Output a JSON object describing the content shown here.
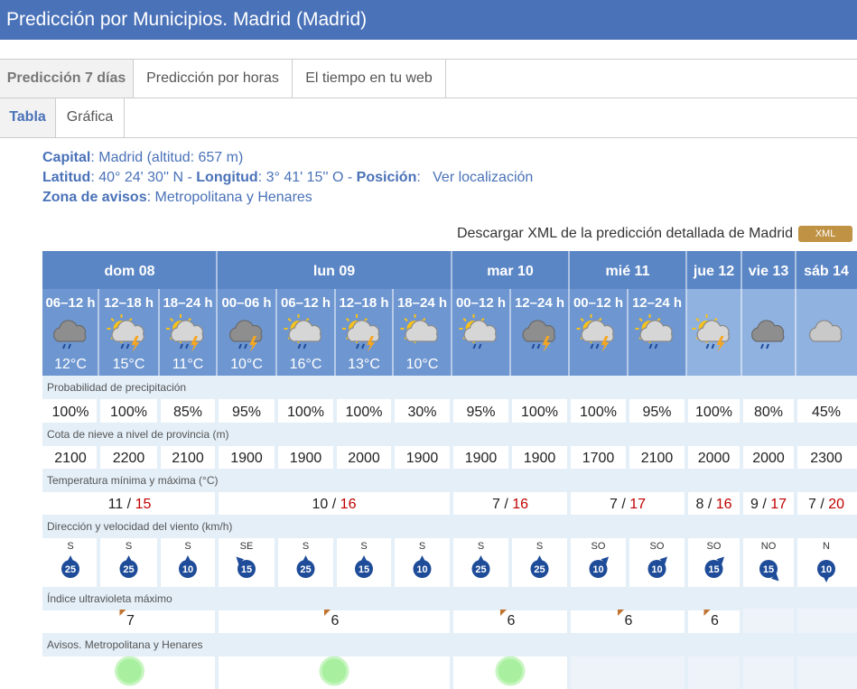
{
  "header": {
    "title": "Predicción por Municipios. Madrid (Madrid)"
  },
  "tabs_main": [
    {
      "label": "Predicción 7 días",
      "active": true
    },
    {
      "label": "Predicción por horas",
      "active": false
    },
    {
      "label": "El tiempo en tu web",
      "active": false
    }
  ],
  "tabs_view": [
    {
      "label": "Tabla",
      "active": true
    },
    {
      "label": "Gráfica",
      "active": false
    }
  ],
  "info": {
    "capital_label": "Capital",
    "capital_value": "Madrid (altitud: 657 m)",
    "lat_label": "Latitud",
    "lat_value": "40° 24' 30'' N - ",
    "lon_label": "Longitud",
    "lon_value": "3° 41' 15'' O - ",
    "pos_label": "Posición",
    "pos_link": "Ver localización",
    "zone_label": "Zona de avisos",
    "zone_value": "Metropolitana y Henares"
  },
  "download": {
    "text": "Descargar XML de la predicción detallada de Madrid",
    "button": "XML"
  },
  "colors": {
    "header_blue": "#4a72b8",
    "row_label_bg": "#e4eff8",
    "temp_max": "#c00000",
    "uv_marker": "#c0722e",
    "aviso_green": "#a8f0a0"
  },
  "forecast": {
    "days": [
      {
        "label": "dom 08",
        "span": 3,
        "min": "11",
        "max": "15",
        "uv": "7",
        "aviso": true
      },
      {
        "label": "lun 09",
        "span": 4,
        "min": "10",
        "max": "16",
        "uv": "6",
        "aviso": true
      },
      {
        "label": "mar 10",
        "span": 2,
        "min": "7",
        "max": "16",
        "uv": "6",
        "aviso": true
      },
      {
        "label": "mié 11",
        "span": 2,
        "min": "7",
        "max": "17",
        "uv": "6",
        "aviso": false
      },
      {
        "label": "jue 12",
        "span": 1,
        "min": "8",
        "max": "16",
        "uv": "6",
        "aviso": false
      },
      {
        "label": "vie 13",
        "span": 1,
        "min": "9",
        "max": "17",
        "uv": "",
        "aviso": false
      },
      {
        "label": "sáb 14",
        "span": 1,
        "min": "7",
        "max": "20",
        "uv": "",
        "aviso": false
      }
    ],
    "periods": [
      {
        "label": "06–12 h",
        "icon": "cloud-rain-icon",
        "temp": "12°C",
        "precip": "100%",
        "snow": "2100",
        "wind_dir": "S",
        "wind_speed": "25"
      },
      {
        "label": "12–18 h",
        "icon": "sun-cloud-storm-icon",
        "temp": "15°C",
        "precip": "100%",
        "snow": "2200",
        "wind_dir": "S",
        "wind_speed": "25"
      },
      {
        "label": "18–24 h",
        "icon": "sun-cloud-storm-icon",
        "temp": "11°C",
        "precip": "85%",
        "snow": "2100",
        "wind_dir": "S",
        "wind_speed": "10"
      },
      {
        "label": "00–06 h",
        "icon": "cloud-storm-icon",
        "temp": "10°C",
        "precip": "95%",
        "snow": "1900",
        "wind_dir": "SE",
        "wind_speed": "15"
      },
      {
        "label": "06–12 h",
        "icon": "sun-cloud-rain-icon",
        "temp": "16°C",
        "precip": "100%",
        "snow": "1900",
        "wind_dir": "S",
        "wind_speed": "25"
      },
      {
        "label": "12–18 h",
        "icon": "sun-cloud-storm-icon",
        "temp": "13°C",
        "precip": "100%",
        "snow": "2000",
        "wind_dir": "S",
        "wind_speed": "15"
      },
      {
        "label": "18–24 h",
        "icon": "sun-cloud-icon",
        "temp": "10°C",
        "precip": "30%",
        "snow": "1900",
        "wind_dir": "S",
        "wind_speed": "10"
      },
      {
        "label": "00–12 h",
        "icon": "sun-cloud-rain-icon",
        "temp": "",
        "precip": "95%",
        "snow": "1900",
        "wind_dir": "S",
        "wind_speed": "25"
      },
      {
        "label": "12–24 h",
        "icon": "cloud-storm-icon",
        "temp": "",
        "precip": "100%",
        "snow": "1900",
        "wind_dir": "S",
        "wind_speed": "25"
      },
      {
        "label": "00–12 h",
        "icon": "sun-cloud-storm-icon",
        "temp": "",
        "precip": "100%",
        "snow": "1700",
        "wind_dir": "SO",
        "wind_speed": "10"
      },
      {
        "label": "12–24 h",
        "icon": "sun-cloud-rain-icon",
        "temp": "",
        "precip": "95%",
        "snow": "2100",
        "wind_dir": "SO",
        "wind_speed": "10"
      },
      {
        "label": "",
        "icon": "sun-cloud-storm-icon",
        "temp": "",
        "precip": "100%",
        "snow": "2000",
        "wind_dir": "SO",
        "wind_speed": "15"
      },
      {
        "label": "",
        "icon": "cloud-rain-icon",
        "temp": "",
        "precip": "80%",
        "snow": "2000",
        "wind_dir": "NO",
        "wind_speed": "15"
      },
      {
        "label": "",
        "icon": "cloud-icon",
        "temp": "",
        "precip": "45%",
        "snow": "2300",
        "wind_dir": "N",
        "wind_speed": "10"
      }
    ],
    "row_labels": {
      "precip": "Probabilidad de precipitación",
      "snow": "Cota de nieve a nivel de provincia (m)",
      "temp": "Temperatura mínima y máxima (°C)",
      "wind": "Dirección y velocidad del viento (km/h)",
      "uv": "Índice ultravioleta máximo",
      "aviso": "Avisos. Metropolitana y Henares"
    }
  }
}
